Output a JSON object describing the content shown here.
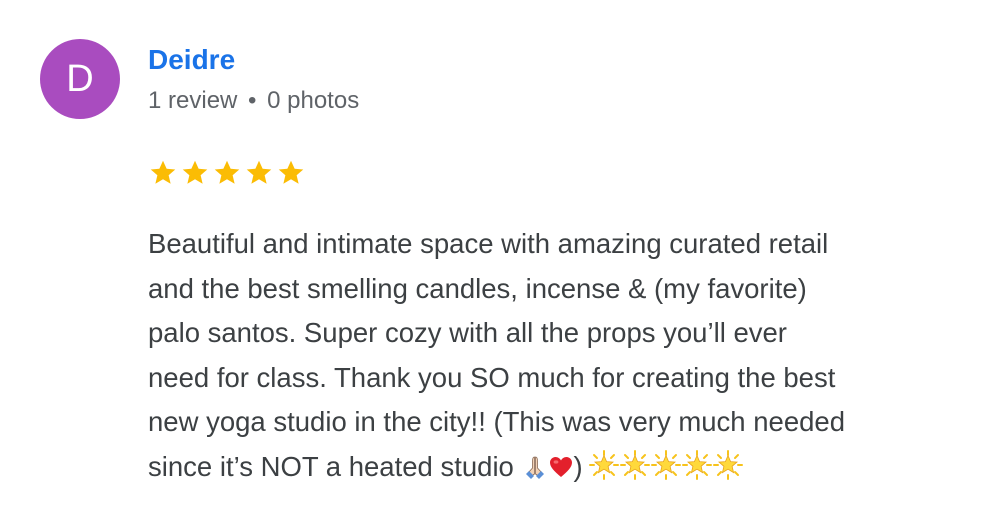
{
  "reviewer": {
    "initial": "D",
    "name": "Deidre",
    "review_count": "1 review",
    "separator": "•",
    "photo_count": "0 photos",
    "avatar_color": "#a94cbf",
    "name_color": "#1a73e8"
  },
  "rating": {
    "value": 5,
    "max": 5,
    "star_color": "#fbbc04"
  },
  "review": {
    "lines": [
      "Beautiful and intimate space with amazing curated retail",
      "and the best smelling candles, incense & (my favorite)",
      "palo santos. Super cozy with all the props you’ll ever",
      "need for class. Thank you SO much for creating the best",
      "new yoga studio in the city!! (This was very much needed",
      "since it’s NOT a heated studio "
    ],
    "closing_paren": ")",
    "emojis": [
      "praying-hands-icon",
      "red-heart-icon"
    ],
    "glowing_star_count": 5
  }
}
